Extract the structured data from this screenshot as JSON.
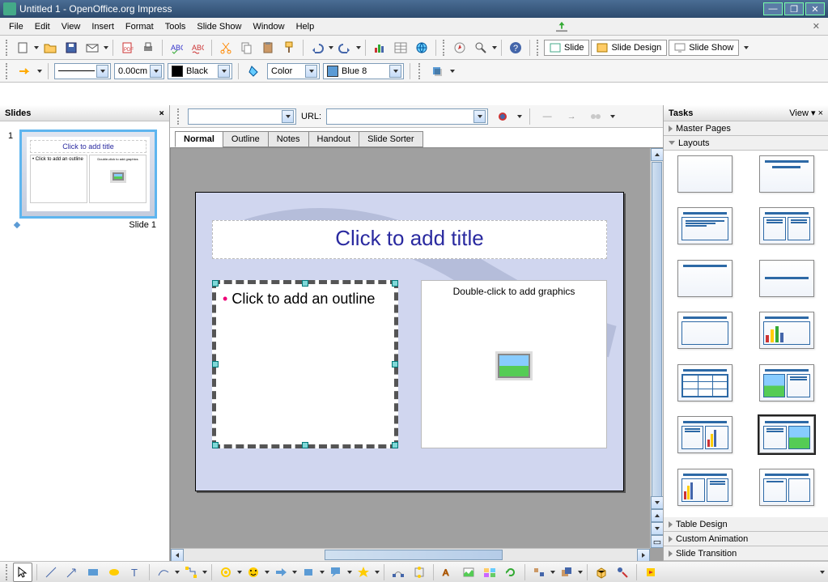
{
  "window": {
    "title": "Untitled 1 - OpenOffice.org Impress"
  },
  "menu": {
    "file": "File",
    "edit": "Edit",
    "view": "View",
    "insert": "Insert",
    "format": "Format",
    "tools": "Tools",
    "slideshow": "Slide Show",
    "window": "Window",
    "help": "Help"
  },
  "toolbar1": {
    "slide": "Slide",
    "slide_design": "Slide Design",
    "slide_show": "Slide Show"
  },
  "toolbar2": {
    "width": "0.00cm",
    "color_name": "Black",
    "fill_mode": "Color",
    "fill_color": "Blue 8"
  },
  "urlbar": {
    "url_label": "URL:"
  },
  "tabs": {
    "normal": "Normal",
    "outline": "Outline",
    "notes": "Notes",
    "handout": "Handout",
    "sorter": "Slide Sorter"
  },
  "slides_panel": {
    "title": "Slides",
    "slide_label": "Slide 1",
    "thumb_title": "Click to add title",
    "thumb_outline": "Click to add an outline",
    "thumb_gfx": "Double-click to add graphics"
  },
  "slide": {
    "title": "Click to add title",
    "outline": "Click to add an outline",
    "gfx": "Double-click to add graphics"
  },
  "tasks": {
    "title": "Tasks",
    "view": "View",
    "master": "Master Pages",
    "layouts": "Layouts",
    "table": "Table Design",
    "anim": "Custom Animation",
    "trans": "Slide Transition"
  }
}
